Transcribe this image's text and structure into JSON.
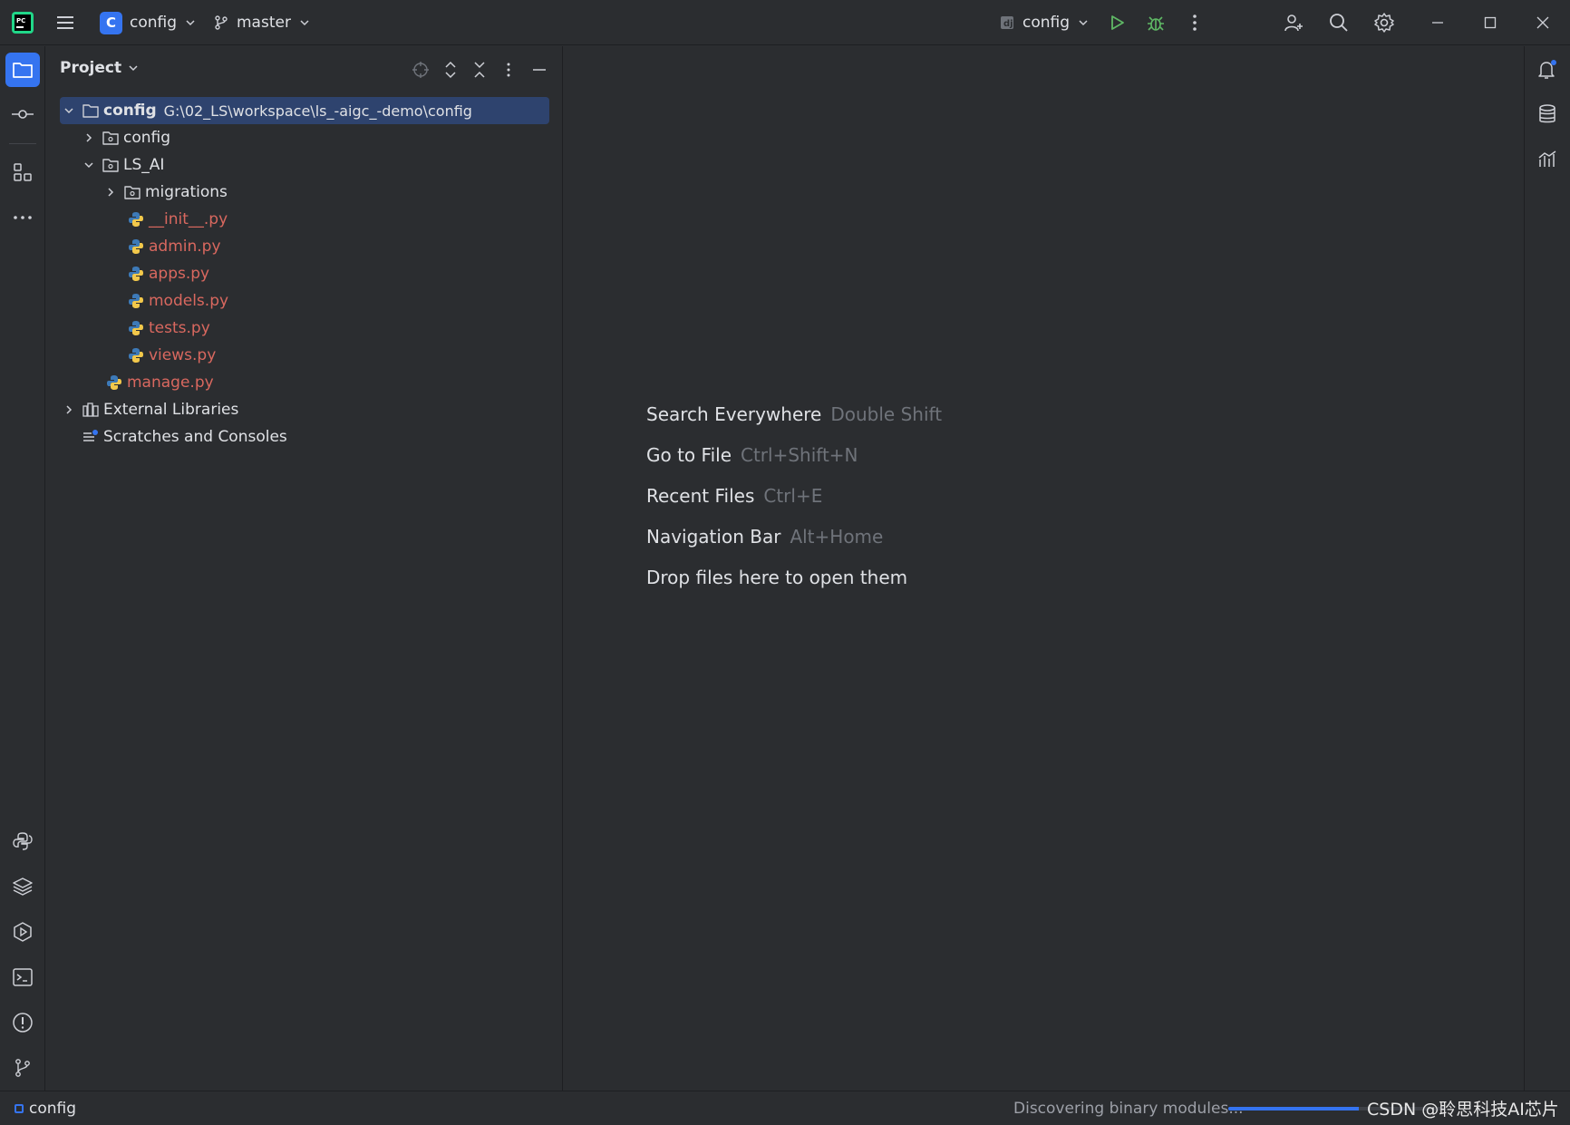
{
  "titlebar": {
    "project_badge": "C",
    "project_name": "config",
    "branch": "master",
    "run_config": "config",
    "icons": [
      "pycharm-logo-icon",
      "main-menu-icon",
      "chevron-down-icon",
      "branch-icon",
      "run-icon",
      "debug-icon",
      "more-icon",
      "add-user-icon",
      "search-icon",
      "settings-icon",
      "minimize-icon",
      "maximize-icon",
      "close-icon"
    ]
  },
  "project_panel": {
    "title": "Project",
    "tree": [
      {
        "label": "config",
        "path": "G:\\02_LS\\workspace\\ls_-aigc_-demo\\config",
        "type": "root-folder"
      },
      {
        "label": "config",
        "type": "package"
      },
      {
        "label": "LS_AI",
        "type": "package"
      },
      {
        "label": "migrations",
        "type": "package"
      },
      {
        "label": "__init__.py",
        "type": "python-file"
      },
      {
        "label": "admin.py",
        "type": "python-file"
      },
      {
        "label": "apps.py",
        "type": "python-file"
      },
      {
        "label": "models.py",
        "type": "python-file"
      },
      {
        "label": "tests.py",
        "type": "python-file"
      },
      {
        "label": "views.py",
        "type": "python-file"
      },
      {
        "label": "manage.py",
        "type": "python-file"
      },
      {
        "label": "External Libraries",
        "type": "libraries"
      },
      {
        "label": "Scratches and Consoles",
        "type": "scratches"
      }
    ]
  },
  "editor": {
    "hints": [
      {
        "action": "Search Everywhere",
        "shortcut": "Double Shift"
      },
      {
        "action": "Go to File",
        "shortcut": "Ctrl+Shift+N"
      },
      {
        "action": "Recent Files",
        "shortcut": "Ctrl+E"
      },
      {
        "action": "Navigation Bar",
        "shortcut": "Alt+Home"
      },
      {
        "action": "Drop files here to open them",
        "shortcut": ""
      }
    ]
  },
  "statusbar": {
    "project": "config",
    "task": "Discovering binary modules...",
    "progress": 0.6,
    "watermark": "CSDN @聆思科技AI芯片"
  },
  "colors": {
    "accent": "#3574f0",
    "selection": "#2e436e",
    "modified_file": "#d9685f",
    "run_green": "#5fb865"
  }
}
